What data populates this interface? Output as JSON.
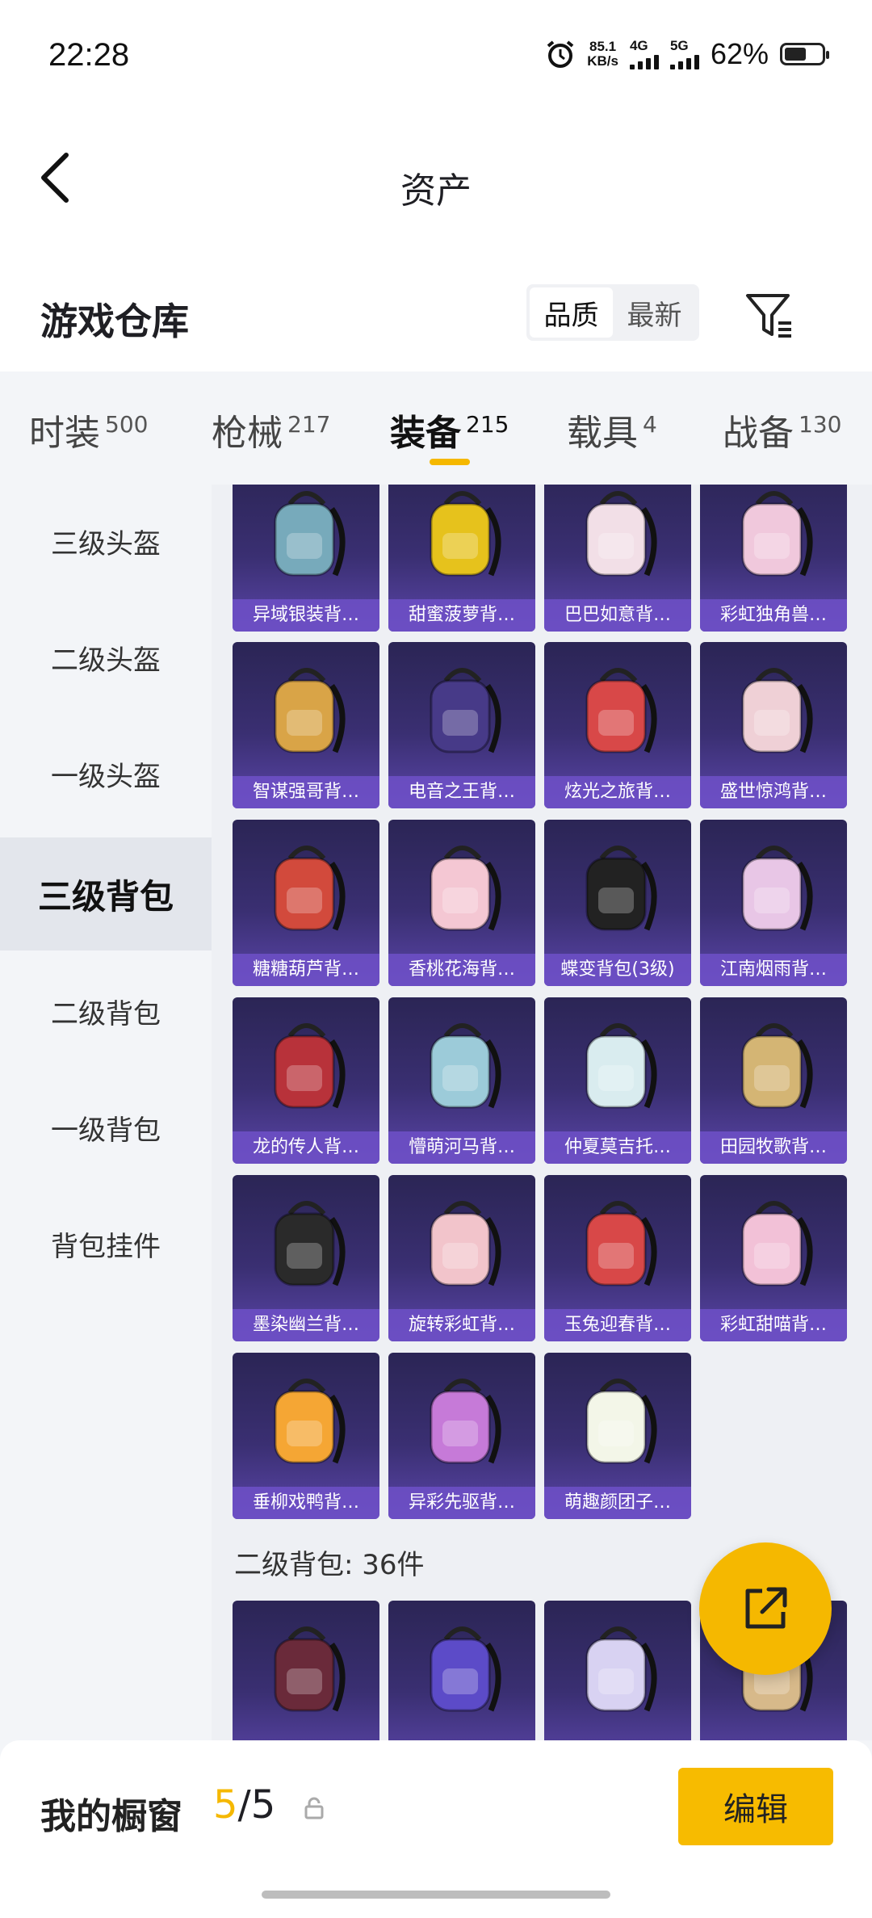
{
  "status_bar": {
    "time": "22:28",
    "net_speed": "85.1",
    "net_unit": "KB/s",
    "net1": "4G",
    "net2": "5G",
    "battery": "62%"
  },
  "header": {
    "title": "资产"
  },
  "section": {
    "title": "游戏仓库",
    "sort_quality": "品质",
    "sort_latest": "最新"
  },
  "tabs": [
    {
      "label": "时装",
      "count": "500"
    },
    {
      "label": "枪械",
      "count": "217"
    },
    {
      "label": "装备",
      "count": "215"
    },
    {
      "label": "载具",
      "count": "4"
    },
    {
      "label": "战备",
      "count": "130"
    }
  ],
  "sidebar": [
    "三级头盔",
    "二级头盔",
    "一级头盔",
    "三级背包",
    "二级背包",
    "一级背包",
    "背包挂件"
  ],
  "items": [
    {
      "name": "异域银装背…",
      "color": "#7ab"
    },
    {
      "name": "甜蜜菠萝背…",
      "color": "#e6c21c"
    },
    {
      "name": "巴巴如意背…",
      "color": "#f2dfe7"
    },
    {
      "name": "彩虹独角兽…",
      "color": "#f0c8dc"
    },
    {
      "name": "智谋强哥背…",
      "color": "#d9a447"
    },
    {
      "name": "电音之王背…",
      "color": "#473a88"
    },
    {
      "name": "炫光之旅背…",
      "color": "#d84848"
    },
    {
      "name": "盛世惊鸿背…",
      "color": "#efd0d6"
    },
    {
      "name": "糖糖葫芦背…",
      "color": "#d24a3c"
    },
    {
      "name": "香桃花海背…",
      "color": "#f4c7d3"
    },
    {
      "name": "蝶变背包(3级)",
      "color": "#222"
    },
    {
      "name": "江南烟雨背…",
      "color": "#e8c6e6"
    },
    {
      "name": "龙的传人背…",
      "color": "#b8323a"
    },
    {
      "name": "懵萌河马背…",
      "color": "#9ccbd9"
    },
    {
      "name": "仲夏莫吉托…",
      "color": "#d9ecef"
    },
    {
      "name": "田园牧歌背…",
      "color": "#d4b574"
    },
    {
      "name": "墨染幽兰背…",
      "color": "#2a2a2a"
    },
    {
      "name": "旋转彩虹背…",
      "color": "#f2c4cb"
    },
    {
      "name": "玉兔迎春背…",
      "color": "#d84848"
    },
    {
      "name": "彩虹甜喵背…",
      "color": "#f2c1d7"
    },
    {
      "name": "垂柳戏鸭背…",
      "color": "#f5a634"
    },
    {
      "name": "异彩先驱背…",
      "color": "#c67ad8"
    },
    {
      "name": "萌趣颜团子…",
      "color": "#f3f6e8"
    }
  ],
  "group2": {
    "title": "二级背包: 36件"
  },
  "items2": [
    {
      "color": "#6a2a3a"
    },
    {
      "color": "#5c4bc8"
    },
    {
      "color": "#d8d2f2"
    },
    {
      "color": "#d7b98a"
    }
  ],
  "bottom": {
    "label": "我的橱窗",
    "current": "5",
    "sep": "/",
    "total": "5",
    "edit": "编辑"
  }
}
